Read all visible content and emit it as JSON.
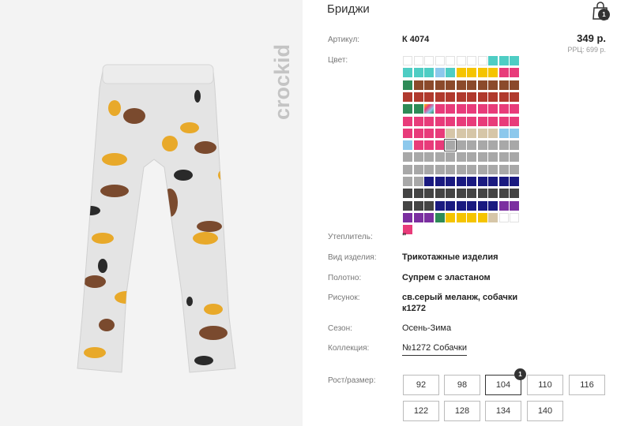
{
  "product": {
    "title": "Бриджи",
    "brand": "crockid",
    "image_description_icon": "leggings-with-dogs-print"
  },
  "cart": {
    "icon": "shopping-bag-icon",
    "count": "1"
  },
  "article": {
    "label": "Артикул:",
    "value": "К 4074"
  },
  "price": {
    "value": "349 р.",
    "rrp": "РРЦ: 699 р."
  },
  "color": {
    "label": "Цвет:",
    "swatch_rows": [
      [
        "#ffffff",
        "#ffffff",
        "#ffffff",
        "#ffffff",
        "#ffffff",
        "#ffffff",
        "#ffffff",
        "#ffffff",
        "#4ecdc4",
        "#4ecdc4",
        "#4ecdc4"
      ],
      [
        "#4ecdc4",
        "#4ecdc4",
        "#4ecdc4",
        "#8cc8ec",
        "#4ecdc4",
        "#f5c400",
        "#f5c400",
        "#f5c400",
        "#f5c400",
        "#e83b7a",
        "#e83b7a"
      ],
      [
        "#2e8b57",
        "#8b4a2b",
        "#8b4a2b",
        "#8b4a2b",
        "#8b4a2b",
        "#8b4a2b",
        "#8b4a2b",
        "#8b4a2b",
        "#8b4a2b",
        "#8b4a2b",
        "#8b4a2b"
      ],
      [
        "#b03a2e",
        "#b03a2e",
        "#b03a2e",
        "#b03a2e",
        "#b03a2e",
        "#b03a2e",
        "#b03a2e",
        "#b03a2e",
        "#b03a2e",
        "#b03a2e",
        "#b03a2e"
      ],
      [
        "#2e8b57",
        "#2e8b57",
        "rainbow",
        "#e83b7a",
        "#e83b7a",
        "#e83b7a",
        "#e83b7a",
        "#e83b7a",
        "#e83b7a",
        "#e83b7a",
        "#e83b7a"
      ],
      [
        "#e83b7a",
        "#e83b7a",
        "#e83b7a",
        "#e83b7a",
        "#e83b7a",
        "#e83b7a",
        "#e83b7a",
        "#e83b7a",
        "#e83b7a",
        "#e83b7a",
        "#e83b7a"
      ],
      [
        "#e83b7a",
        "#e83b7a",
        "#e83b7a",
        "#e83b7a",
        "#d6c6a8",
        "#d6c6a8",
        "#d6c6a8",
        "#d6c6a8",
        "#d6c6a8",
        "#8cc8ec",
        "#8cc8ec"
      ],
      [
        "#8cc8ec",
        "#e83b7a",
        "#e83b7a",
        "#e83b7a",
        "#a8a8a8",
        "#a8a8a8",
        "#a8a8a8",
        "#a8a8a8",
        "#a8a8a8",
        "#a8a8a8",
        "#a8a8a8"
      ],
      [
        "#a8a8a8",
        "#a8a8a8",
        "#a8a8a8",
        "#a8a8a8",
        "#a8a8a8",
        "#a8a8a8",
        "#a8a8a8",
        "#a8a8a8",
        "#a8a8a8",
        "#a8a8a8",
        "#a8a8a8"
      ],
      [
        "#a8a8a8",
        "#a8a8a8",
        "#a8a8a8",
        "#a8a8a8",
        "#a8a8a8",
        "#a8a8a8",
        "#a8a8a8",
        "#a8a8a8",
        "#a8a8a8",
        "#a8a8a8",
        "#a8a8a8"
      ],
      [
        "#a8a8a8",
        "#a8a8a8",
        "#1a1a80",
        "#1a1a80",
        "#1a1a80",
        "#1a1a80",
        "#1a1a80",
        "#1a1a80",
        "#1a1a80",
        "#1a1a80",
        "#1a1a80"
      ],
      [
        "#444444",
        "#444444",
        "#444444",
        "#444444",
        "#444444",
        "#444444",
        "#444444",
        "#444444",
        "#444444",
        "#444444",
        "#444444"
      ],
      [
        "#444444",
        "#444444",
        "#444444",
        "#1a1a80",
        "#1a1a80",
        "#1a1a80",
        "#1a1a80",
        "#1a1a80",
        "#1a1a80",
        "#7b2fa0",
        "#7b2fa0"
      ],
      [
        "#7b2fa0",
        "#7b2fa0",
        "#7b2fa0",
        "#2e8b57",
        "#f5c400",
        "#f5c400",
        "#f5c400",
        "#f5c400",
        "#d6c6a8",
        "#ffffff",
        "#ffffff"
      ],
      [
        "#e83b7a"
      ]
    ],
    "selected_row": 7,
    "selected_col": 4
  },
  "details": [
    {
      "label": "Утеплитель:",
      "value": "\""
    },
    {
      "label": "Вид изделия:",
      "value": "Трикотажные изделия"
    },
    {
      "label": "Полотно:",
      "value": "Супрем с эластаном"
    },
    {
      "label": "Рисунок:",
      "value": "св.серый меланж, собачки",
      "value2": "к1272"
    },
    {
      "label": "Сезон:",
      "value": "Осень-Зима"
    },
    {
      "label": "Коллекция:",
      "value": "№1272 Собачки"
    }
  ],
  "sizes": {
    "label": "Рост/размер:",
    "options": [
      "92",
      "98",
      "104",
      "110",
      "116",
      "122",
      "128",
      "134",
      "140"
    ],
    "selected": "104",
    "selected_badge": "1"
  }
}
